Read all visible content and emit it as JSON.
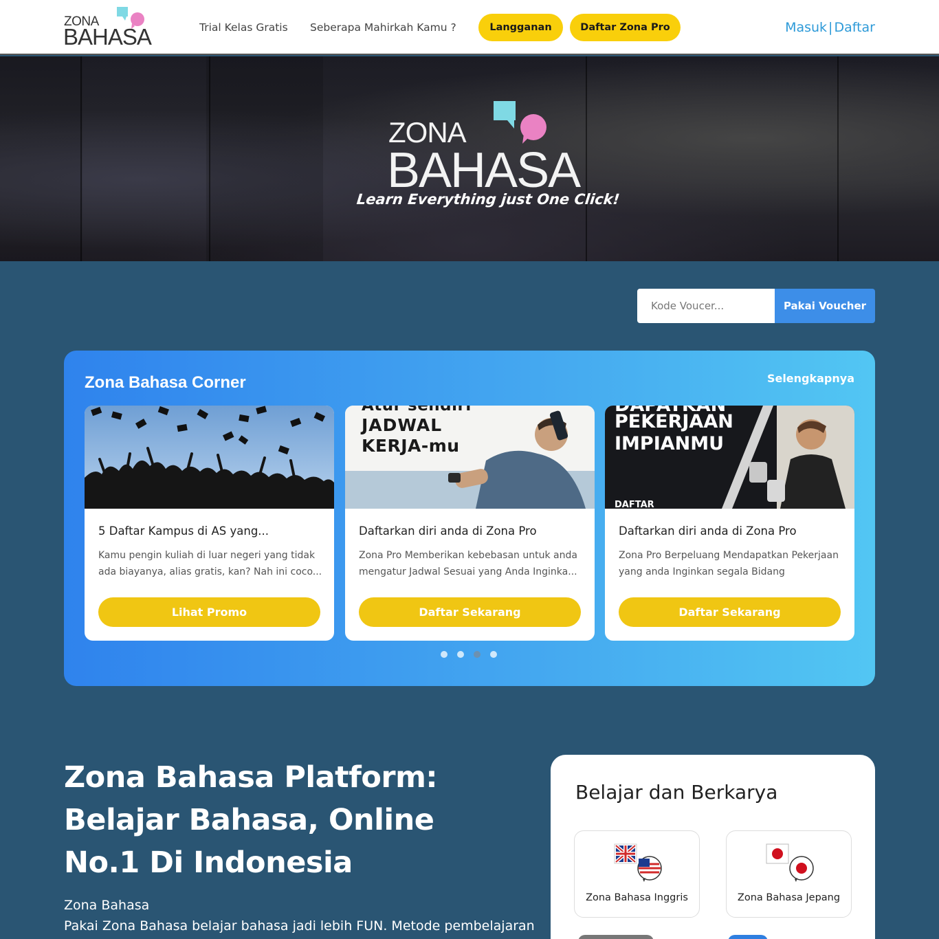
{
  "header": {
    "logo_top": "ZONA",
    "logo_bottom": "BAHASA",
    "nav": [
      "Trial Kelas Gratis",
      "Seberapa Mahirkah Kamu ?"
    ],
    "btn_langganan": "Langganan",
    "btn_zona_pro": "Daftar Zona Pro",
    "masuk": "Masuk",
    "sep": "|",
    "daftar": "Daftar"
  },
  "hero": {
    "logo_top": "ZONA",
    "logo_bottom": "BAHASA",
    "tagline": "Learn Everything just One Click!"
  },
  "voucher": {
    "placeholder": "Kode Voucer...",
    "button": "Pakai Voucher"
  },
  "corner": {
    "title": "Zona Bahasa Corner",
    "more": "Selengkapnya",
    "cards": [
      {
        "title": "5 Daftar Kampus di AS yang...",
        "desc": "Kamu pengin kuliah di luar negeri yang tidak ada biayanya, alias gratis, kan? Nah ini coco...",
        "button": "Lihat Promo"
      },
      {
        "title": "Daftarkan diri anda di Zona Pro",
        "desc": "Zona Pro Memberikan kebebasan untuk anda mengatur Jadwal Sesuai yang Anda Inginka...",
        "button": "Daftar Sekarang",
        "image_text": [
          "Atur sendiri",
          "JADWAL",
          "KERJA-mu"
        ]
      },
      {
        "title": "Daftarkan diri anda di Zona Pro",
        "desc": "Zona Pro Berpeluang Mendapatkan Pekerjaan yang anda Inginkan segala Bidang",
        "button": "Daftar Sekarang",
        "image_text": [
          "DAPATKAN",
          "PEKERJAAN",
          "IMPIANMU",
          "DAFTAR"
        ]
      }
    ],
    "slide_count": 4,
    "active_slide": 3
  },
  "platform": {
    "heading": "Zona Bahasa Platform: Belajar Bahasa, Online No.1 Di Indonesia",
    "brand": "Zona Bahasa",
    "desc": "Pakai Zona Bahasa belajar bahasa jadi lebih FUN. Metode pembelajaran"
  },
  "belajar": {
    "title": "Belajar dan Berkarya",
    "items": [
      "Zona Bahasa Inggris",
      "Zona Bahasa Jepang"
    ]
  },
  "colors": {
    "accent_yellow": "#f9cf0b",
    "link_blue": "#2d9ad8",
    "page_bg": "#2a5573"
  }
}
